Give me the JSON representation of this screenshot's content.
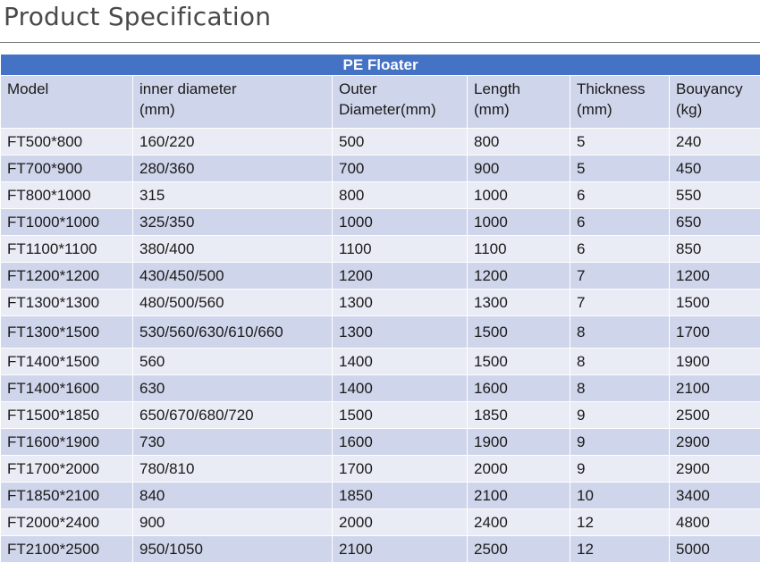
{
  "page": {
    "title": "Product Specification"
  },
  "table": {
    "caption": "PE Floater",
    "columns": [
      {
        "line1": "Model",
        "line2": ""
      },
      {
        "line1": "inner diameter",
        "line2": "(mm)"
      },
      {
        "line1": "Outer",
        "line2": "Diameter(mm)"
      },
      {
        "line1": "Length",
        "line2": "(mm)"
      },
      {
        "line1": "Thickness",
        "line2": "(mm)"
      },
      {
        "line1": "Bouyancy",
        "line2": "(kg)"
      }
    ],
    "rows": [
      [
        "FT500*800",
        "160/220",
        "500",
        "800",
        "5",
        "240"
      ],
      [
        "FT700*900",
        "280/360",
        "700",
        "900",
        "5",
        "450"
      ],
      [
        "FT800*1000",
        "315",
        "800",
        "1000",
        "6",
        "550"
      ],
      [
        "FT1000*1000",
        "325/350",
        "1000",
        "1000",
        "6",
        "650"
      ],
      [
        "FT1100*1100",
        "380/400",
        "1100",
        "1100",
        "6",
        "850"
      ],
      [
        "FT1200*1200",
        "430/450/500",
        "1200",
        "1200",
        "7",
        "1200"
      ],
      [
        "FT1300*1300",
        "480/500/560",
        "1300",
        "1300",
        "7",
        "1500"
      ],
      [
        "FT1300*1500",
        "530/560/630/610/660",
        "1300",
        "1500",
        "8",
        "1700"
      ],
      [
        "FT1400*1500",
        "560",
        "1400",
        "1500",
        "8",
        "1900"
      ],
      [
        "FT1400*1600",
        "630",
        "1400",
        "1600",
        "8",
        "2100"
      ],
      [
        "FT1500*1850",
        "650/670/680/720",
        "1500",
        "1850",
        "9",
        "2500"
      ],
      [
        "FT1600*1900",
        "730",
        "1600",
        "1900",
        "9",
        "2900"
      ],
      [
        "FT1700*2000",
        "780/810",
        "1700",
        "2000",
        "9",
        "2900"
      ],
      [
        "FT1850*2100",
        "840",
        "1850",
        "2100",
        "10",
        "3400"
      ],
      [
        "FT2000*2400",
        "900",
        "2000",
        "2400",
        "12",
        "4800"
      ],
      [
        "FT2100*2500",
        "950/1050",
        "2100",
        "2500",
        "12",
        "5000"
      ]
    ]
  },
  "colors": {
    "caption_bg": "#4472c4",
    "row_dark": "#cfd5ea",
    "row_light": "#e9ebf5"
  }
}
